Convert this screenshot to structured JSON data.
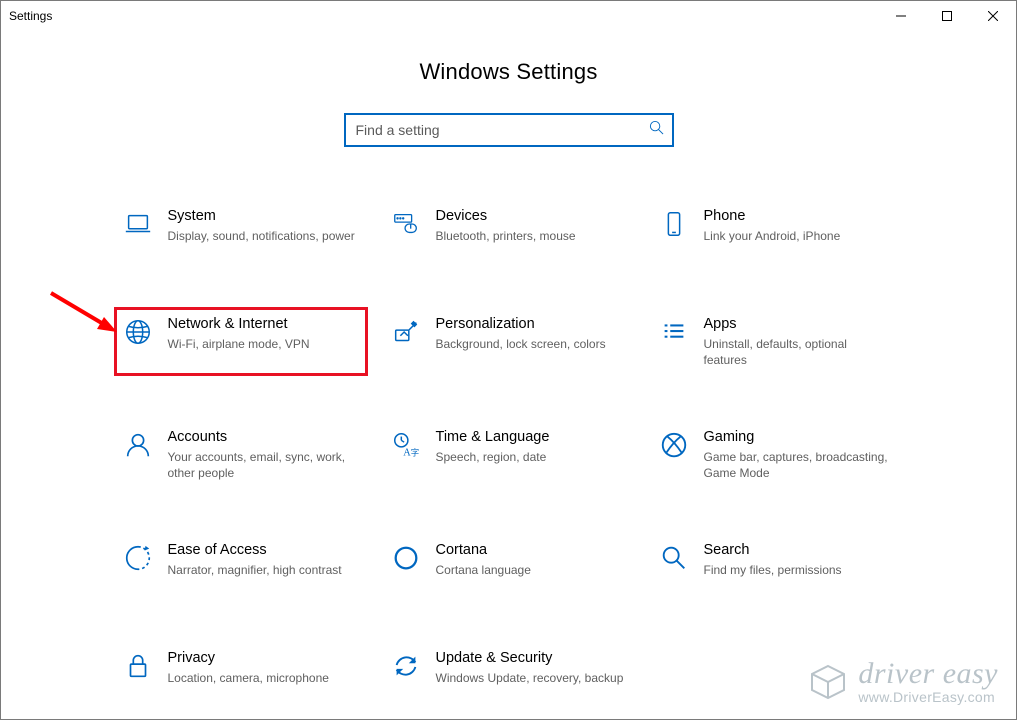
{
  "window": {
    "title": "Settings"
  },
  "page": {
    "heading": "Windows Settings"
  },
  "search": {
    "placeholder": "Find a setting"
  },
  "tiles": {
    "system": {
      "title": "System",
      "desc": "Display, sound, notifications, power"
    },
    "devices": {
      "title": "Devices",
      "desc": "Bluetooth, printers, mouse"
    },
    "phone": {
      "title": "Phone",
      "desc": "Link your Android, iPhone"
    },
    "network": {
      "title": "Network & Internet",
      "desc": "Wi-Fi, airplane mode, VPN"
    },
    "personalization": {
      "title": "Personalization",
      "desc": "Background, lock screen, colors"
    },
    "apps": {
      "title": "Apps",
      "desc": "Uninstall, defaults, optional features"
    },
    "accounts": {
      "title": "Accounts",
      "desc": "Your accounts, email, sync, work, other people"
    },
    "time": {
      "title": "Time & Language",
      "desc": "Speech, region, date"
    },
    "gaming": {
      "title": "Gaming",
      "desc": "Game bar, captures, broadcasting, Game Mode"
    },
    "ease": {
      "title": "Ease of Access",
      "desc": "Narrator, magnifier, high contrast"
    },
    "cortana": {
      "title": "Cortana",
      "desc": "Cortana language"
    },
    "search2": {
      "title": "Search",
      "desc": "Find my files, permissions"
    },
    "privacy": {
      "title": "Privacy",
      "desc": "Location, camera, microphone"
    },
    "update": {
      "title": "Update & Security",
      "desc": "Windows Update, recovery, backup"
    }
  },
  "watermark": {
    "name": "driver easy",
    "url": "www.DriverEasy.com"
  },
  "colors": {
    "accent": "#0067c0",
    "highlight": "#e81123",
    "arrow": "#ff0000"
  }
}
